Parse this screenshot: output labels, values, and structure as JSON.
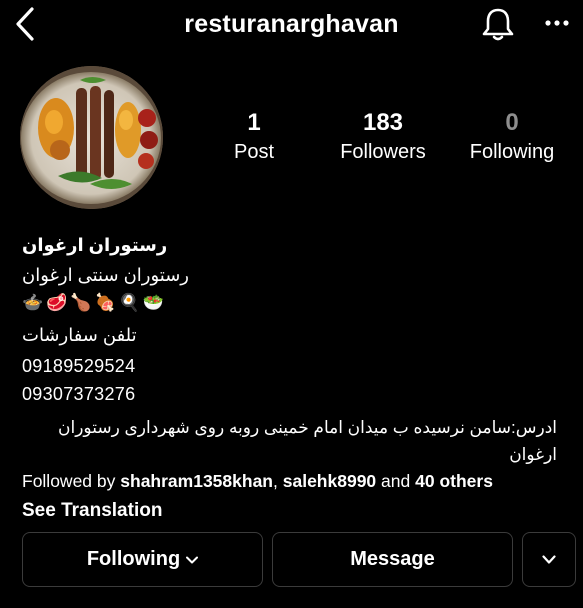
{
  "header": {
    "username": "resturanarghavan",
    "icons": {
      "back": "back-arrow-icon",
      "notifications": "bell-icon",
      "more": "more-dots-icon"
    }
  },
  "profile": {
    "avatar": "food-platter-image"
  },
  "stats": {
    "posts": {
      "value": "1",
      "label": "Post"
    },
    "followers": {
      "value": "183",
      "label": "Followers"
    },
    "following": {
      "value": "0",
      "label": "Following"
    }
  },
  "bio": {
    "name": "رستوران ارغوان",
    "tagline": "رستوران سنتی ارغوان",
    "emojis": [
      "🍲",
      "🥩",
      "🍗",
      "🍖",
      "🍳",
      "🥗"
    ],
    "order_phone_label": "تلفن سفارشات",
    "phone_1": "09189529524",
    "phone_2": "09307373276",
    "address": "ادرس:سامن نرسیده ب میدان امام خمینی روبه روی شهرداری رستوران ارغوان"
  },
  "followed_by": {
    "prefix": "Followed by",
    "user_1": "shahram1358khan",
    "separator": ",",
    "user_2": "salehk8990",
    "and": "and",
    "others": "40 others"
  },
  "see_translation": "See Translation",
  "buttons": {
    "following": "Following",
    "message": "Message"
  }
}
